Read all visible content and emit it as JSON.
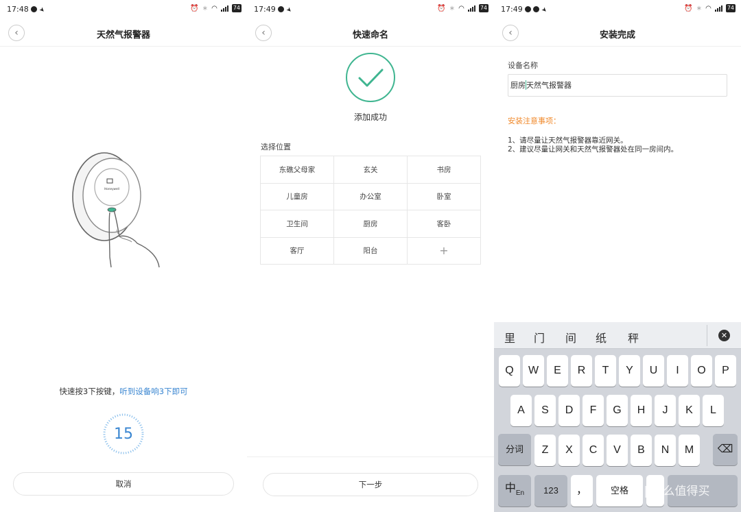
{
  "panel1": {
    "status": {
      "time": "17:48",
      "battery": "74"
    },
    "title": "天然气报警器",
    "hint_text": "快速按3下按键，",
    "hint_link": "听到设备响3下即可",
    "countdown": "15",
    "device_brand": "Honeywell",
    "cancel_label": "取消"
  },
  "panel2": {
    "status": {
      "time": "17:49",
      "battery": "74"
    },
    "title": "快速命名",
    "success_text": "添加成功",
    "location_label": "选择位置",
    "locations": [
      "东礁父母家",
      "玄关",
      "书房",
      "儿童房",
      "办公室",
      "卧室",
      "卫生间",
      "厨房",
      "客卧",
      "客厅",
      "阳台",
      "+"
    ],
    "next_label": "下一步"
  },
  "panel3": {
    "status": {
      "time": "17:49",
      "battery": "74"
    },
    "title": "安装完成",
    "field_label": "设备名称",
    "name_prefix": "厨房",
    "name_suffix": "天然气报警器",
    "notice_title": "安装注意事项：",
    "notice_1": "1、请尽量让天然气报警器靠近网关。",
    "notice_2": "2、建议尽量让网关和天然气报警器处在同一房间内。",
    "keyboard": {
      "candidates": [
        "里",
        "门",
        "间",
        "纸",
        "秤"
      ],
      "row1": [
        "Q",
        "W",
        "E",
        "R",
        "T",
        "Y",
        "U",
        "I",
        "O",
        "P"
      ],
      "row2": [
        "A",
        "S",
        "D",
        "F",
        "G",
        "H",
        "J",
        "K",
        "L"
      ],
      "row3": [
        "Z",
        "X",
        "C",
        "V",
        "B",
        "N",
        "M"
      ],
      "split_label": "分词",
      "lang_label": "中",
      "lang_sub": "En",
      "num_label": "123",
      "comma_label": "，",
      "space_label": "空格",
      "watermark": "值 | 什么值得买"
    }
  },
  "colors": {
    "accent_blue": "#3a86d1",
    "success_green": "#3fb590",
    "notice_orange": "#f08a2c"
  }
}
